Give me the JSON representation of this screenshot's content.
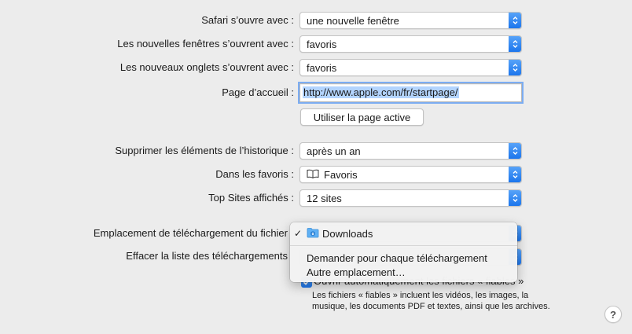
{
  "general": {
    "safari_opens_with": {
      "label": "Safari s’ouvre avec :",
      "value": "une nouvelle fenêtre"
    },
    "new_windows_open_with": {
      "label": "Les nouvelles fenêtres s’ouvrent avec :",
      "value": "favoris"
    },
    "new_tabs_open_with": {
      "label": "Les nouveaux onglets s’ouvrent avec :",
      "value": "favoris"
    },
    "homepage": {
      "label": "Page d’accueil :",
      "value": "http://www.apple.com/fr/startpage/"
    },
    "use_current_page_button": "Utiliser la page active",
    "remove_history": {
      "label": "Supprimer les éléments de l’historique :",
      "value": "après un an"
    },
    "favorites_shows": {
      "label": "Dans les favoris :",
      "value": "Favoris",
      "icon": "book-icon"
    },
    "top_sites_shows": {
      "label": "Top Sites affichés :",
      "value": "12 sites"
    },
    "download_location": {
      "label": "Emplacement de téléchargement du fichier"
    },
    "remove_download_list": {
      "label": "Effacer la liste des téléchargements"
    },
    "open_safe_files": {
      "checked": true,
      "label": "Ouvrir automatiquement les fichiers « fiables »",
      "help_text": "Les fichiers « fiables » incluent les vidéos, les images, la musique, les documents PDF et textes, ainsi que les archives."
    },
    "help_button": "?"
  },
  "download_menu": {
    "items": [
      {
        "label": "Downloads",
        "checked": true,
        "icon": "downloads-folder-icon"
      },
      {
        "label": "Demander pour chaque téléchargement",
        "checked": false
      },
      {
        "label": "Autre emplacement…",
        "checked": false
      }
    ]
  },
  "colors": {
    "accent": "#1b74ec",
    "window_bg": "#ececec",
    "selection": "#b3d4fe"
  }
}
